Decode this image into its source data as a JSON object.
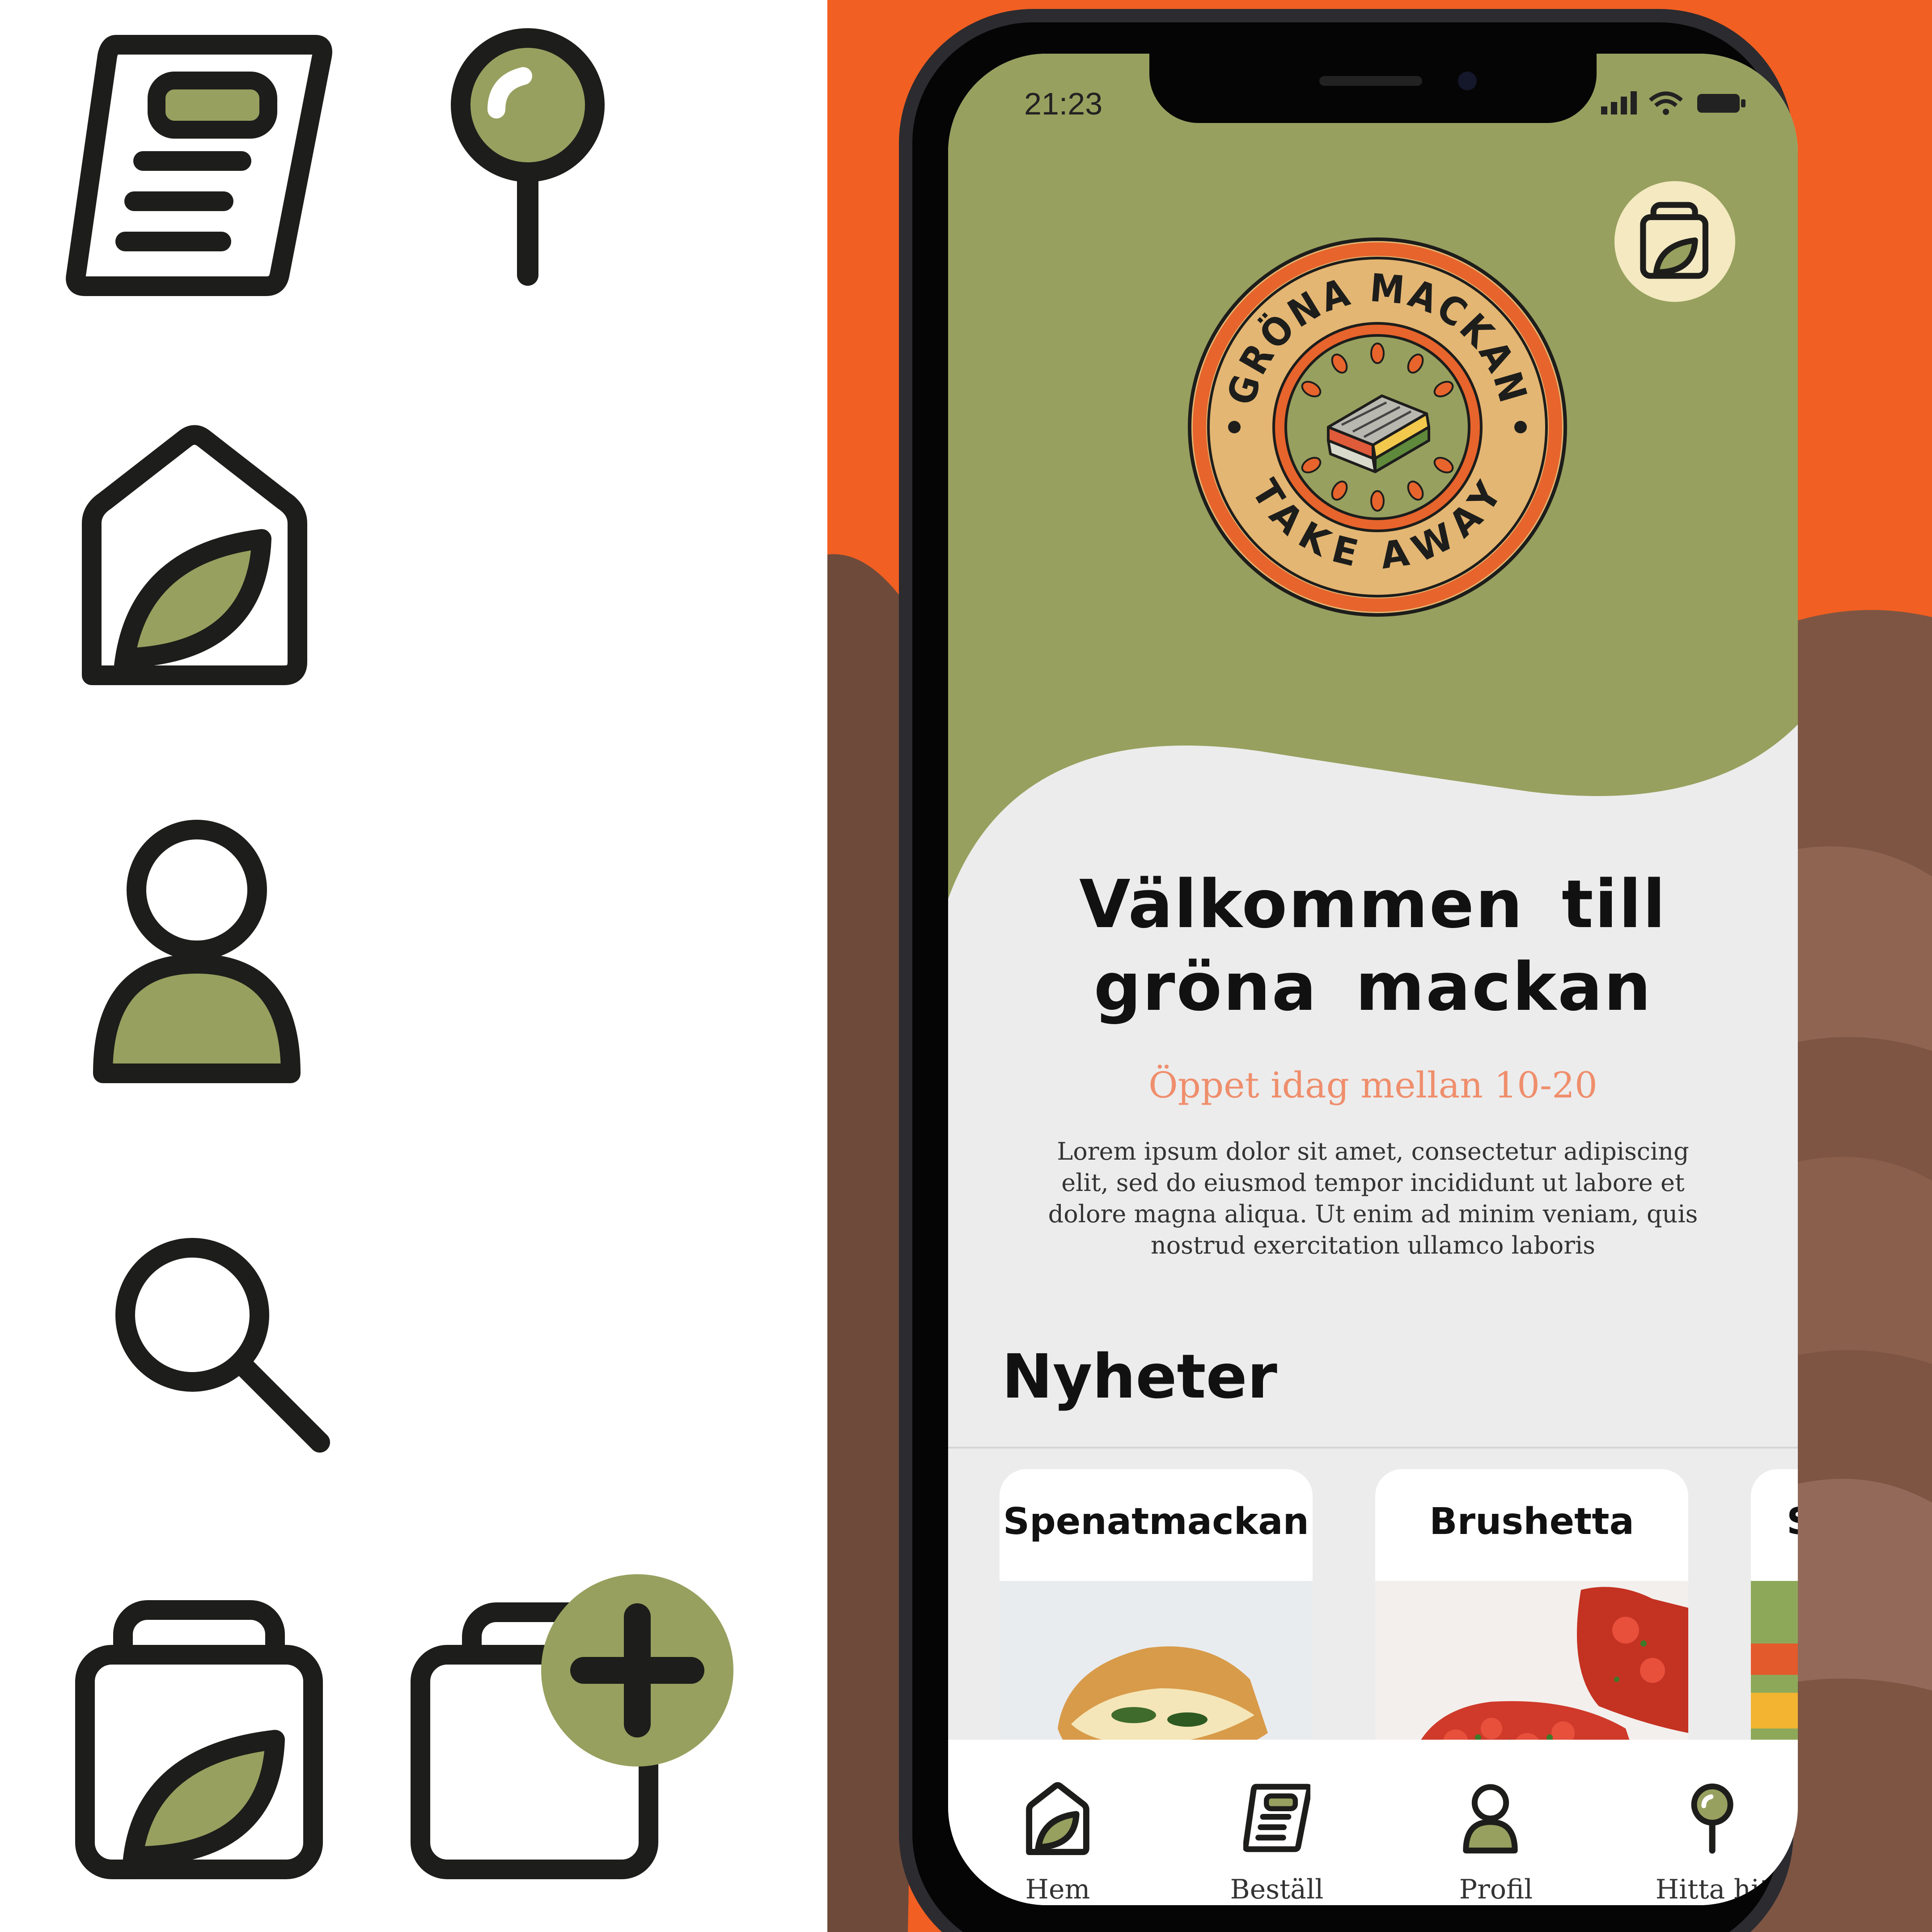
{
  "colors": {
    "accent_green": "#97a05e",
    "orange": "#f15f22",
    "dark": "#1d1d1b",
    "cream": "#f4e9c1",
    "salmon": "#ef8e6c",
    "logo_tan": "#e3b673",
    "logo_ring": "#e7642c"
  },
  "icon_sheet": {
    "icons": [
      "menu-document-icon",
      "map-pin-icon",
      "home-leaf-icon",
      "user-icon",
      "search-icon",
      "bag-leaf-icon",
      "bag-add-icon"
    ]
  },
  "status_bar": {
    "time": "21:23",
    "icons": [
      "signal-icon",
      "wifi-icon",
      "battery-icon"
    ]
  },
  "header": {
    "cart_icon": "bag-leaf-icon",
    "logo": {
      "top_text": "GRÖNA MACKAN",
      "bottom_text": "TAKE AWAY"
    }
  },
  "welcome": {
    "line1": "Välkommen till",
    "line2": "gröna mackan",
    "open_hours": "Öppet idag mellan 10-20",
    "description": "Lorem ipsum dolor sit amet, consectetur adipiscing elit, sed do eiusmod tempor incididunt ut labore et dolore magna aliqua. Ut enim ad minim veniam, quis nostrud exercitation ullamco laboris"
  },
  "news": {
    "title": "Nyheter",
    "cards": [
      {
        "title": "Spenatmackan"
      },
      {
        "title": "Brushetta"
      },
      {
        "title": "S"
      }
    ]
  },
  "nav": {
    "items": [
      {
        "label": "Hem",
        "icon": "home-leaf-icon"
      },
      {
        "label": "Beställ",
        "icon": "menu-document-icon"
      },
      {
        "label": "Profil",
        "icon": "user-icon"
      },
      {
        "label": "Hitta hit",
        "icon": "map-pin-icon"
      }
    ]
  }
}
